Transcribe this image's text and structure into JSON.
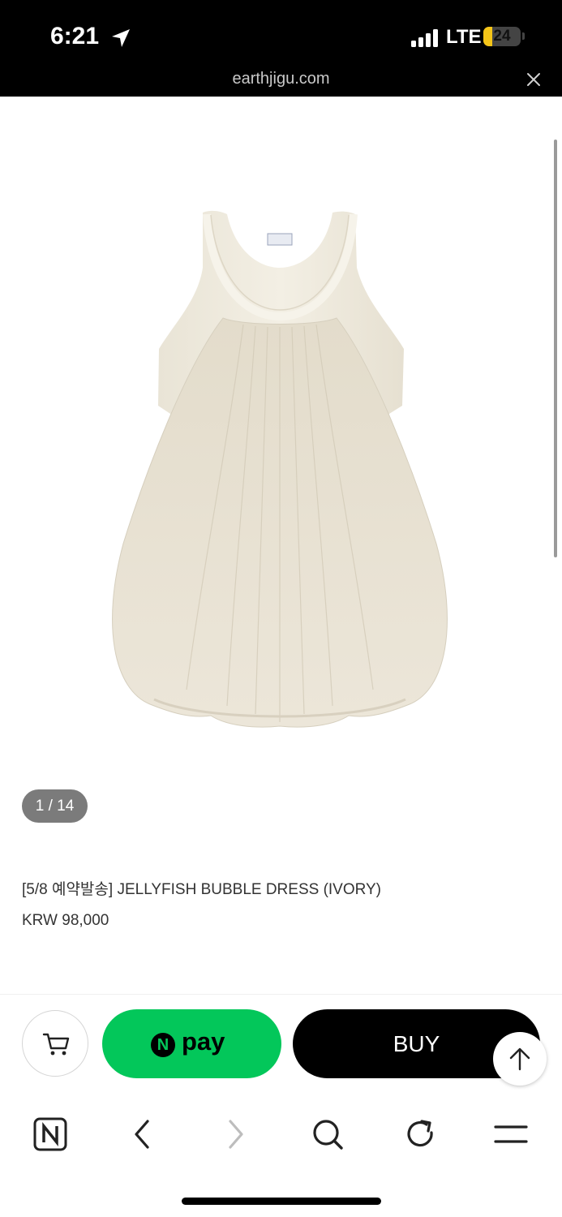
{
  "status": {
    "time": "6:21",
    "network": "LTE",
    "battery": "24",
    "battery_level": 0.24
  },
  "browser": {
    "url": "earthjigu.com"
  },
  "gallery": {
    "counter": "1 / 14"
  },
  "product": {
    "title": "[5/8 예약발송] JELLYFISH BUBBLE DRESS (IVORY)",
    "price": "KRW 98,000"
  },
  "actions": {
    "npay_badge": "N",
    "npay_label": "pay",
    "buy_label": "BUY"
  },
  "nav": {
    "home_badge": "N"
  },
  "icons": {
    "location": "location-arrow-icon",
    "signal": "signal-bars-icon",
    "close": "close-icon",
    "cart": "cart-icon",
    "scroll_top": "arrow-up-icon",
    "back": "chevron-left-icon",
    "forward": "chevron-right-icon",
    "search": "search-icon",
    "refresh": "refresh-icon",
    "menu": "menu-icon"
  },
  "colors": {
    "npay_green": "#03c75a",
    "buy_black": "#000000",
    "battery_yellow": "#f5c518"
  }
}
